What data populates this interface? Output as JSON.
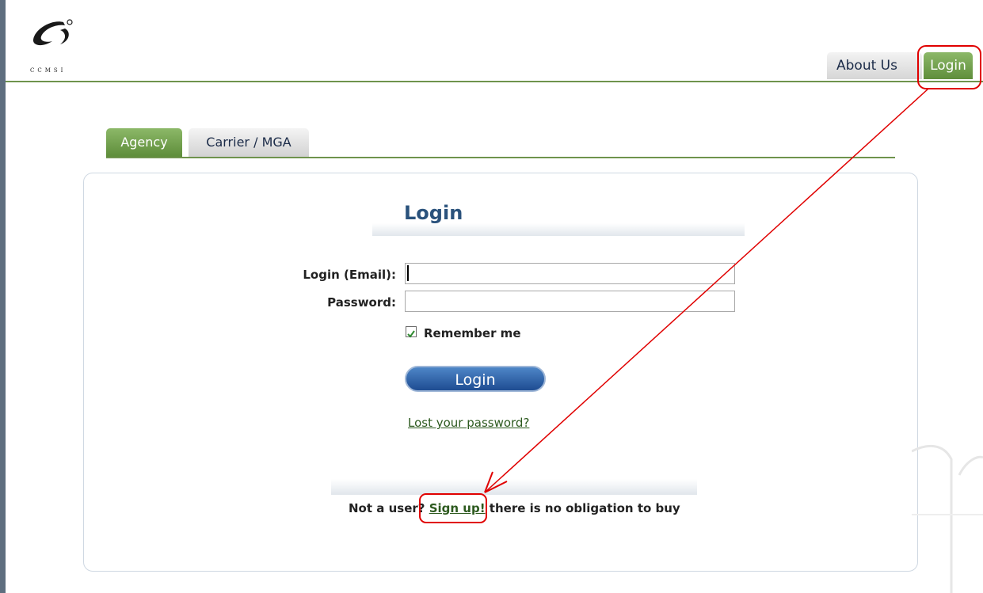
{
  "branding": {
    "logo_text": "CCMSI"
  },
  "nav": {
    "about_label": "About Us",
    "login_label": "Login"
  },
  "tabs": {
    "agency_label": "Agency",
    "carrier_label": "Carrier / MGA"
  },
  "form": {
    "title": "Login",
    "email_label": "Login (Email):",
    "email_value": "",
    "password_label": "Password:",
    "password_value": "",
    "remember_label": "Remember me",
    "remember_checked": true,
    "submit_label": "Login",
    "lost_password_label": "Lost your password?"
  },
  "signup": {
    "prefix": "Not a user?",
    "link_label": "Sign up!",
    "suffix": "there is no obligation to buy"
  },
  "colors": {
    "green_tab": "#6f934d",
    "blue_button": "#1e4c92",
    "annotation_red": "#e00000"
  }
}
